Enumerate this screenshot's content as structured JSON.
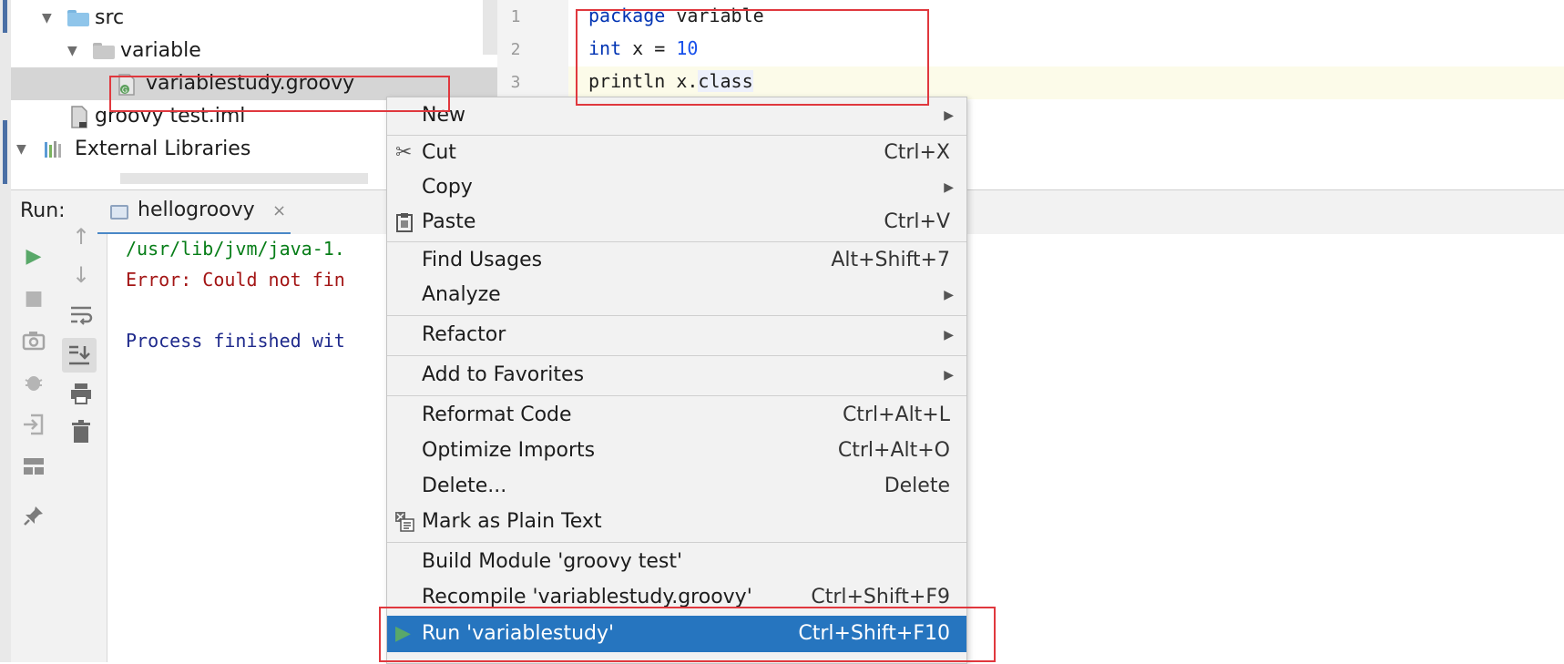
{
  "project_tree": {
    "items": [
      {
        "label": "src"
      },
      {
        "label": "variable"
      },
      {
        "label": "variablestudy.groovy"
      },
      {
        "label": "groovy test.iml"
      },
      {
        "label": "External Libraries"
      }
    ]
  },
  "editor": {
    "lines": [
      {
        "no": "1",
        "kw": "package",
        "rest": " variable"
      },
      {
        "no": "2",
        "kw": "int",
        "mid": " x = ",
        "num": "10"
      },
      {
        "no": "3",
        "text": "println x.",
        "field": "class"
      }
    ]
  },
  "run_panel": {
    "label": "Run:",
    "tab_label": "hellogroovy",
    "tab_close": "×",
    "console": [
      {
        "text": "/usr/lib/jvm/java-1.",
        "color": "#067d17"
      },
      {
        "text": "Error: Could not fin",
        "color": "#a31515"
      },
      {
        "text": "Process finished wit",
        "color": "#1f2a8c"
      }
    ]
  },
  "context_menu": {
    "items": [
      {
        "label": "New",
        "submenu": true
      },
      {
        "label": "Cut",
        "shortcut": "Ctrl+X",
        "icon": "scissors-icon"
      },
      {
        "label": "Copy",
        "submenu": true
      },
      {
        "label": "Paste",
        "shortcut": "Ctrl+V",
        "icon": "clipboard-icon"
      },
      {
        "label": "Find Usages",
        "shortcut": "Alt+Shift+7"
      },
      {
        "label": "Analyze",
        "submenu": true
      },
      {
        "label": "Refactor",
        "submenu": true
      },
      {
        "label": "Add to Favorites",
        "submenu": true
      },
      {
        "label": "Reformat Code",
        "shortcut": "Ctrl+Alt+L"
      },
      {
        "label": "Optimize Imports",
        "shortcut": "Ctrl+Alt+O"
      },
      {
        "label": "Delete...",
        "shortcut": "Delete"
      },
      {
        "label": "Mark as Plain Text",
        "icon": "plain-text-icon"
      },
      {
        "label": "Build Module 'groovy test'"
      },
      {
        "label": "Recompile 'variablestudy.groovy'",
        "shortcut": "Ctrl+Shift+F9"
      },
      {
        "label": "Run 'variablestudy'",
        "shortcut": "Ctrl+Shift+F10",
        "icon": "run-icon",
        "highlighted": true
      }
    ]
  },
  "colors": {
    "annotation_red": "#e0383e",
    "menu_highlight": "#2675bf",
    "run_green": "#59a869",
    "keyword_blue": "#0033b3"
  }
}
